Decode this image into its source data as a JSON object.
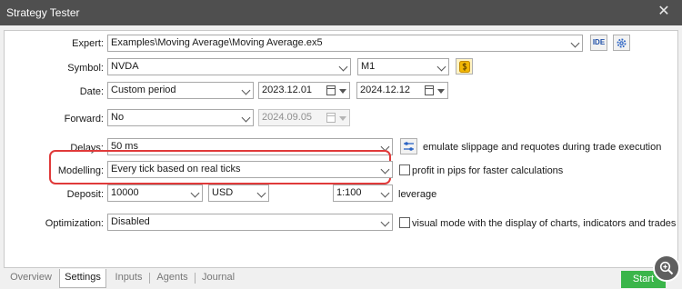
{
  "window": {
    "title": "Strategy Tester",
    "close_symbol": "✕"
  },
  "expert": {
    "label": "Expert:",
    "value": "Examples\\Moving Average\\Moving Average.ex5",
    "ide_label": "IDE"
  },
  "symbol": {
    "label": "Symbol:",
    "value": "NVDA",
    "timeframe": "M1"
  },
  "date": {
    "label": "Date:",
    "mode": "Custom period",
    "from": "2023.12.01",
    "to": "2024.12.12"
  },
  "forward": {
    "label": "Forward:",
    "mode": "No",
    "date": "2024.09.05"
  },
  "delays": {
    "label": "Delays:",
    "value": "50 ms",
    "note": "emulate slippage and requotes during trade execution"
  },
  "modelling": {
    "label": "Modelling:",
    "value": "Every tick based on real ticks",
    "checkbox_label": "profit in pips for faster calculations"
  },
  "deposit": {
    "label": "Deposit:",
    "amount": "10000",
    "currency": "USD",
    "leverage_value": "1:100",
    "leverage_label": "leverage"
  },
  "optimization": {
    "label": "Optimization:",
    "value": "Disabled",
    "visual_label": "visual mode with the display of charts, indicators and trades"
  },
  "tabs": [
    {
      "label": "Overview"
    },
    {
      "label": "Settings"
    },
    {
      "label": "Inputs"
    },
    {
      "label": "Agents"
    },
    {
      "label": "Journal"
    }
  ],
  "start_label": "Start",
  "colors": {
    "titlebar": "#4f4f4f",
    "start": "#3bb54a",
    "highlight": "#e03a3a",
    "coin": "#f2b705"
  }
}
